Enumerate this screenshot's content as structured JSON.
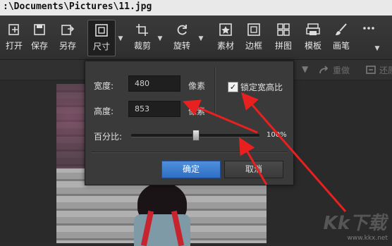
{
  "window": {
    "path_title": ":\\Documents\\Pictures\\11.jpg"
  },
  "toolbar": {
    "items": [
      {
        "label": "打开",
        "icon": "open-icon"
      },
      {
        "label": "保存",
        "icon": "save-icon"
      },
      {
        "label": "另存",
        "icon": "save-as-icon"
      },
      {
        "label": "尺寸",
        "icon": "resize-icon"
      },
      {
        "label": "裁剪",
        "icon": "crop-icon"
      },
      {
        "label": "旋转",
        "icon": "rotate-icon"
      },
      {
        "label": "素材",
        "icon": "sticker-icon"
      },
      {
        "label": "边框",
        "icon": "frame-icon"
      },
      {
        "label": "拼图",
        "icon": "collage-icon"
      },
      {
        "label": "模板",
        "icon": "template-icon"
      },
      {
        "label": "画笔",
        "icon": "brush-icon"
      }
    ],
    "more_icon": "more-icon",
    "dropdown_glyph": "▼"
  },
  "subbar": {
    "redo": "重做",
    "restore": "还原"
  },
  "dialog": {
    "width_label": "宽度:",
    "width_value": "480",
    "width_unit": "像素",
    "height_label": "高度:",
    "height_value": "853",
    "height_unit": "像素",
    "lock_ratio_label": "锁定宽高比",
    "lock_ratio_checked": true,
    "lock_check_glyph": "✓",
    "percent_label": "百分比:",
    "percent_value": "100%",
    "percent_slider_level": 0.5,
    "ok_label": "确定",
    "cancel_label": "取消"
  },
  "watermark": {
    "main": "Kk下载",
    "url": "www.kkx.net"
  },
  "colors": {
    "annotation_arrow": "#e8201f",
    "ok_button": "#3a7fd5",
    "toolbar_bg": "#353535"
  }
}
